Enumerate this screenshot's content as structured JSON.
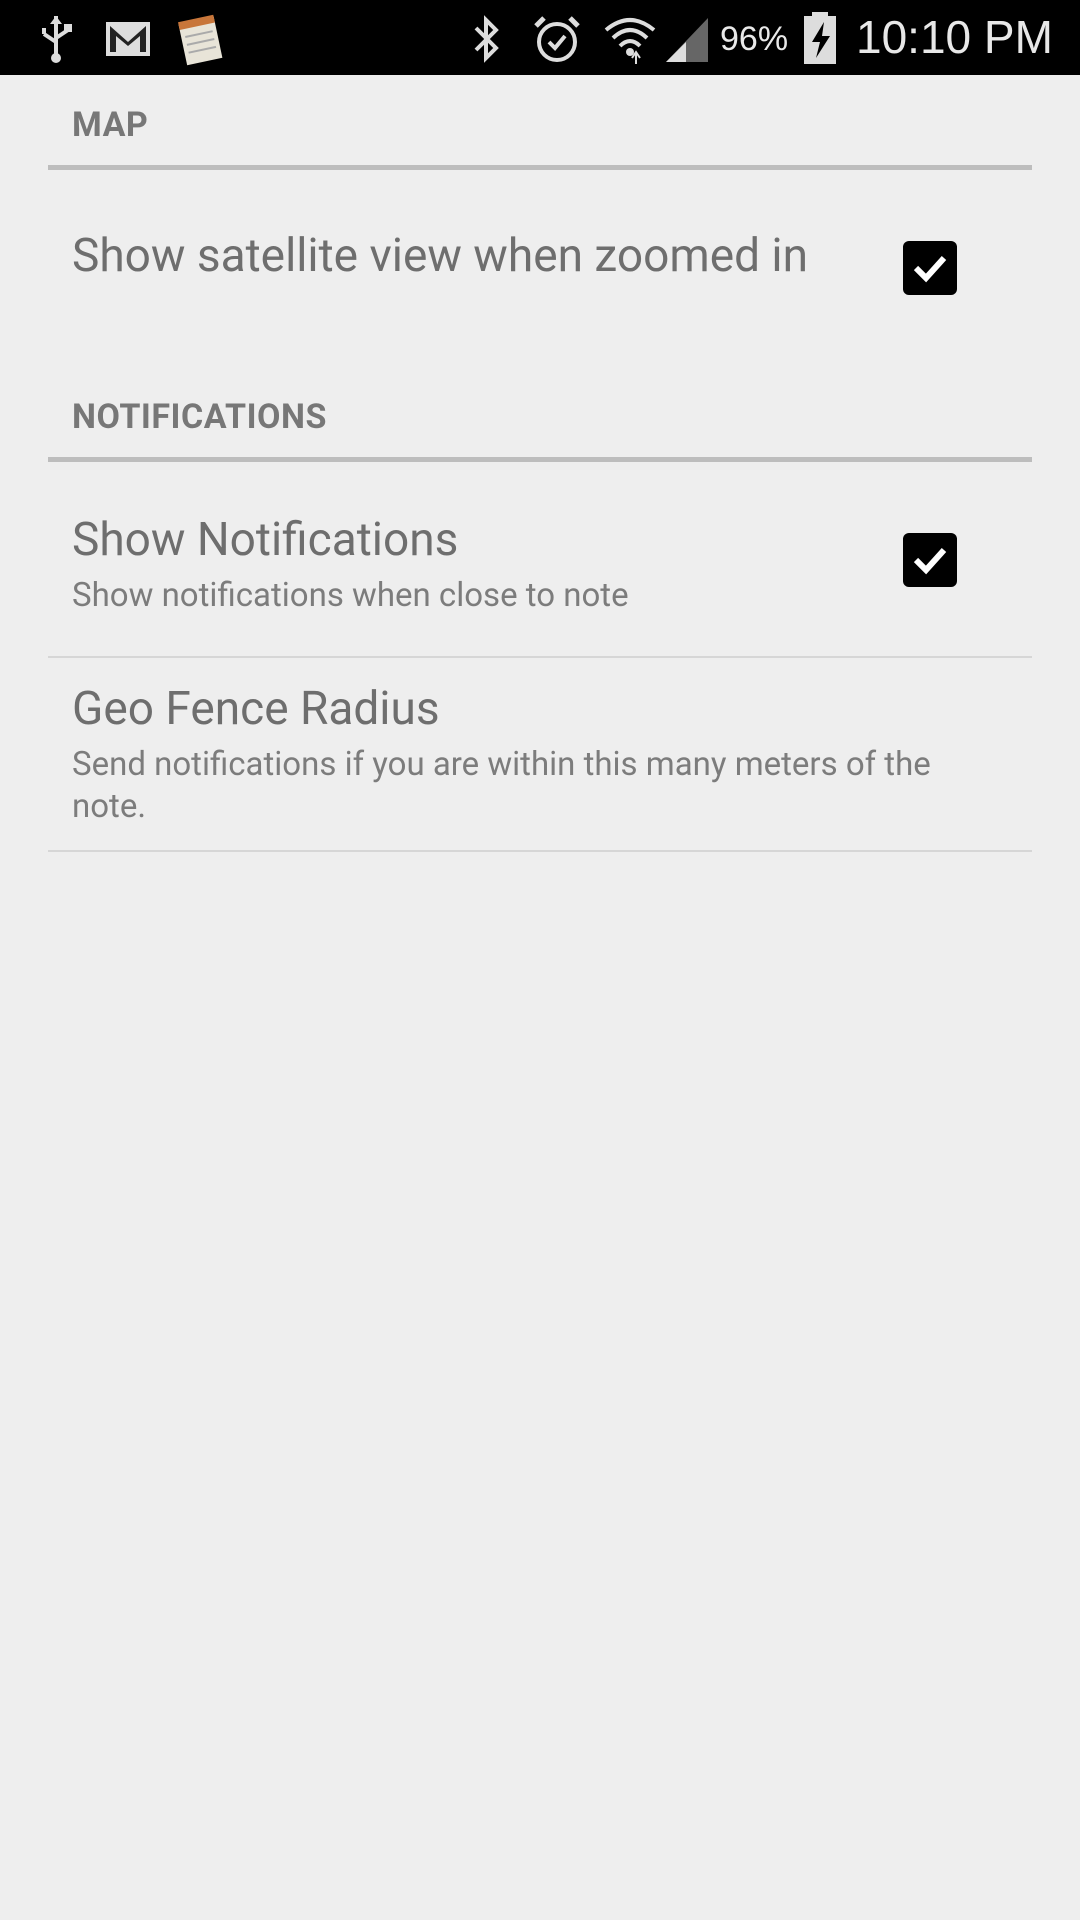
{
  "status_bar": {
    "battery_percent": "96%",
    "time": "10:10 PM",
    "left_icons": [
      "usb-icon",
      "gmail-icon",
      "notes-app-icon"
    ],
    "right_icons": [
      "bluetooth-icon",
      "alarm-icon",
      "wifi-icon",
      "signal-icon",
      "battery-charging-icon"
    ]
  },
  "sections": {
    "map": {
      "title": "MAP",
      "satellite_view": {
        "title": "Show satellite view when zoomed in",
        "checked": true
      }
    },
    "notifications": {
      "title": "NOTIFICATIONS",
      "show_notifications": {
        "title": "Show Notifications",
        "summary": "Show notifications when close to note",
        "checked": true
      },
      "geo_fence": {
        "title": "Geo Fence Radius",
        "summary": "Send notifications if you are within this many meters of the note."
      }
    }
  },
  "colors": {
    "background": "#eeeeee",
    "header_text": "#777777",
    "checkbox": "#000000"
  }
}
